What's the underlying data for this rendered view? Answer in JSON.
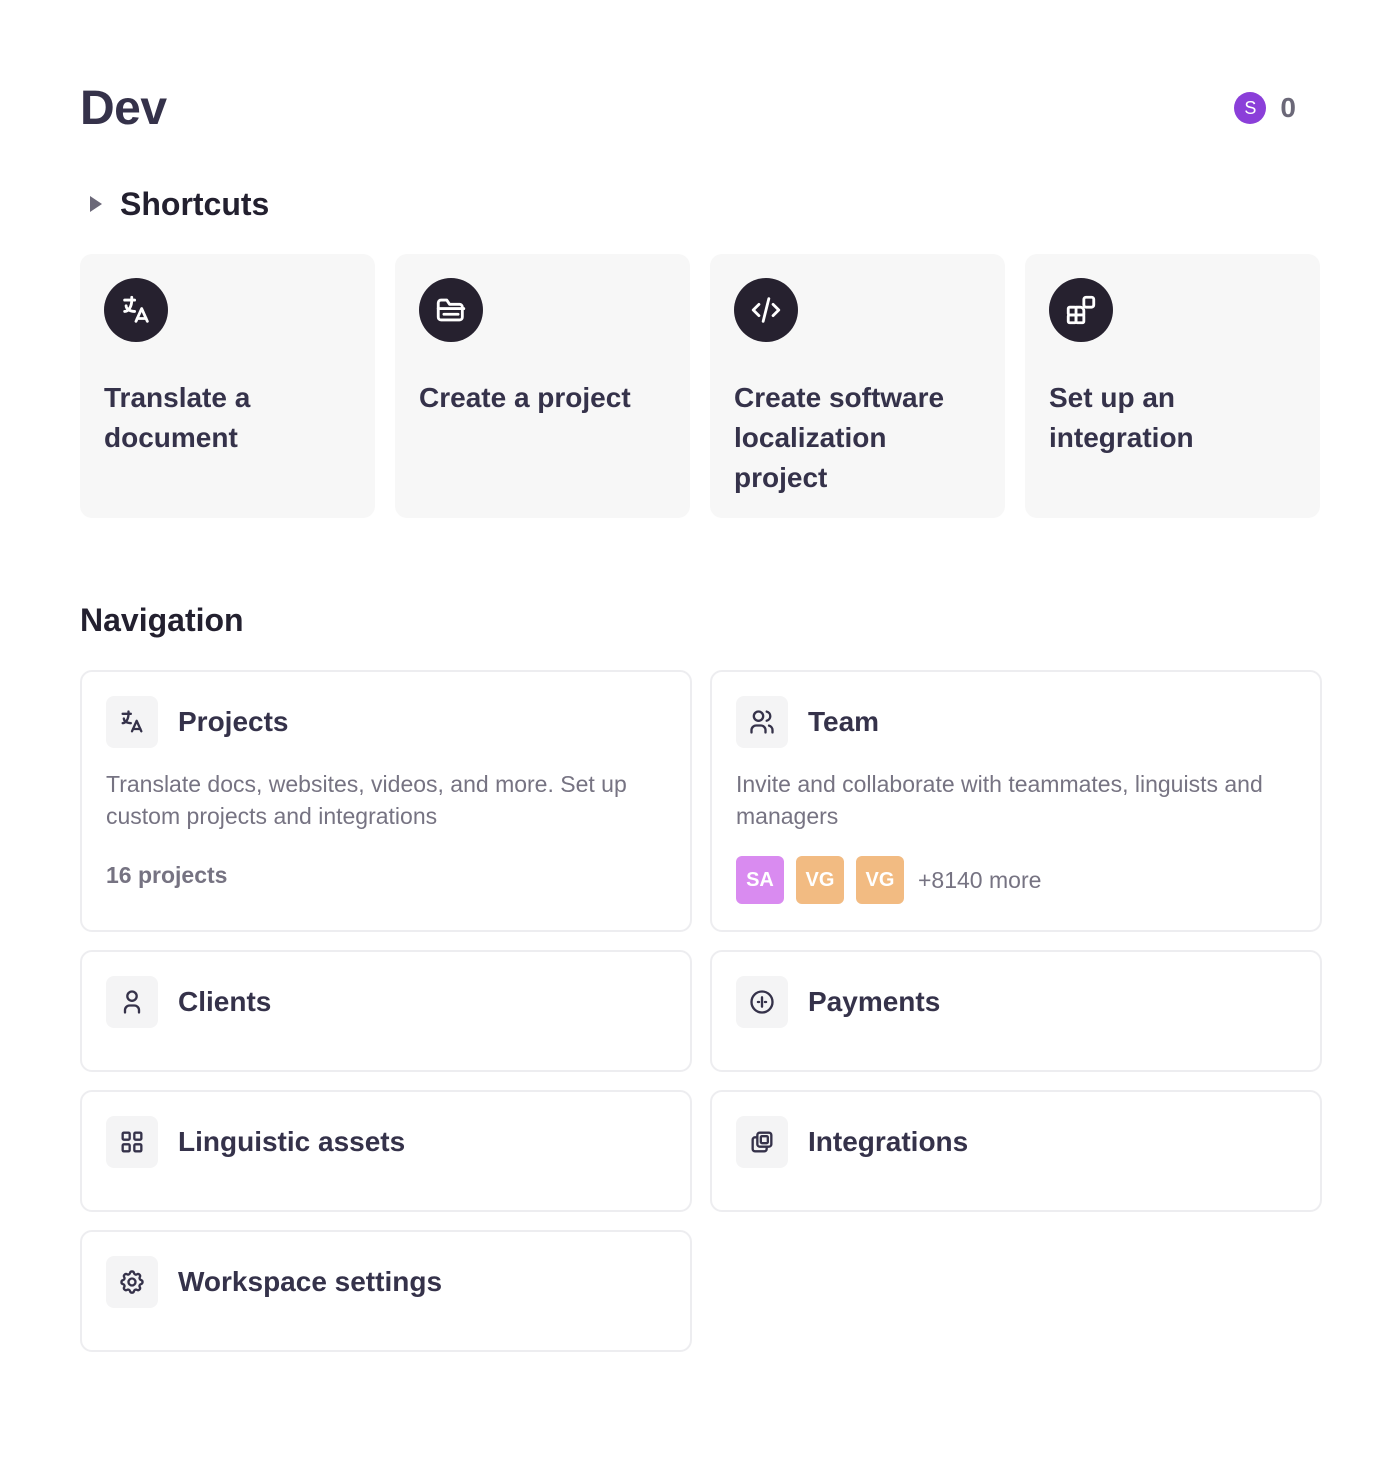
{
  "header": {
    "title": "Dev",
    "credit_initial": "S",
    "credit_count": "0"
  },
  "shortcuts": {
    "title": "Shortcuts",
    "items": [
      {
        "label": "Translate a document",
        "icon": "translate-icon"
      },
      {
        "label": "Create a project",
        "icon": "folder-open-icon"
      },
      {
        "label": "Create software localization project",
        "icon": "code-icon"
      },
      {
        "label": "Set up an integration",
        "icon": "apps-add-icon"
      }
    ]
  },
  "navigation": {
    "title": "Navigation",
    "projects": {
      "label": "Projects",
      "icon": "translate-icon",
      "description": "Translate docs, websites, videos, and more. Set up custom projects and integrations",
      "meta": "16 projects"
    },
    "team": {
      "label": "Team",
      "icon": "users-icon",
      "description": "Invite and collaborate with teammates, linguists and managers",
      "avatars": [
        {
          "initials": "SA",
          "color": "#d98bf0"
        },
        {
          "initials": "VG",
          "color": "#f2bb82"
        },
        {
          "initials": "VG",
          "color": "#f2bb82"
        }
      ],
      "more": "+8140 more"
    },
    "clients": {
      "label": "Clients",
      "icon": "user-icon"
    },
    "payments": {
      "label": "Payments",
      "icon": "coin-icon"
    },
    "linguistic_assets": {
      "label": "Linguistic assets",
      "icon": "grid-icon"
    },
    "integrations": {
      "label": "Integrations",
      "icon": "layers-icon"
    },
    "workspace_settings": {
      "label": "Workspace settings",
      "icon": "gear-icon"
    }
  },
  "colors": {
    "credit_badge": "#8b3fd9",
    "shortcut_icon_bg": "#26212f",
    "card_bg": "#f7f7f7",
    "card_border": "#ededf0"
  }
}
